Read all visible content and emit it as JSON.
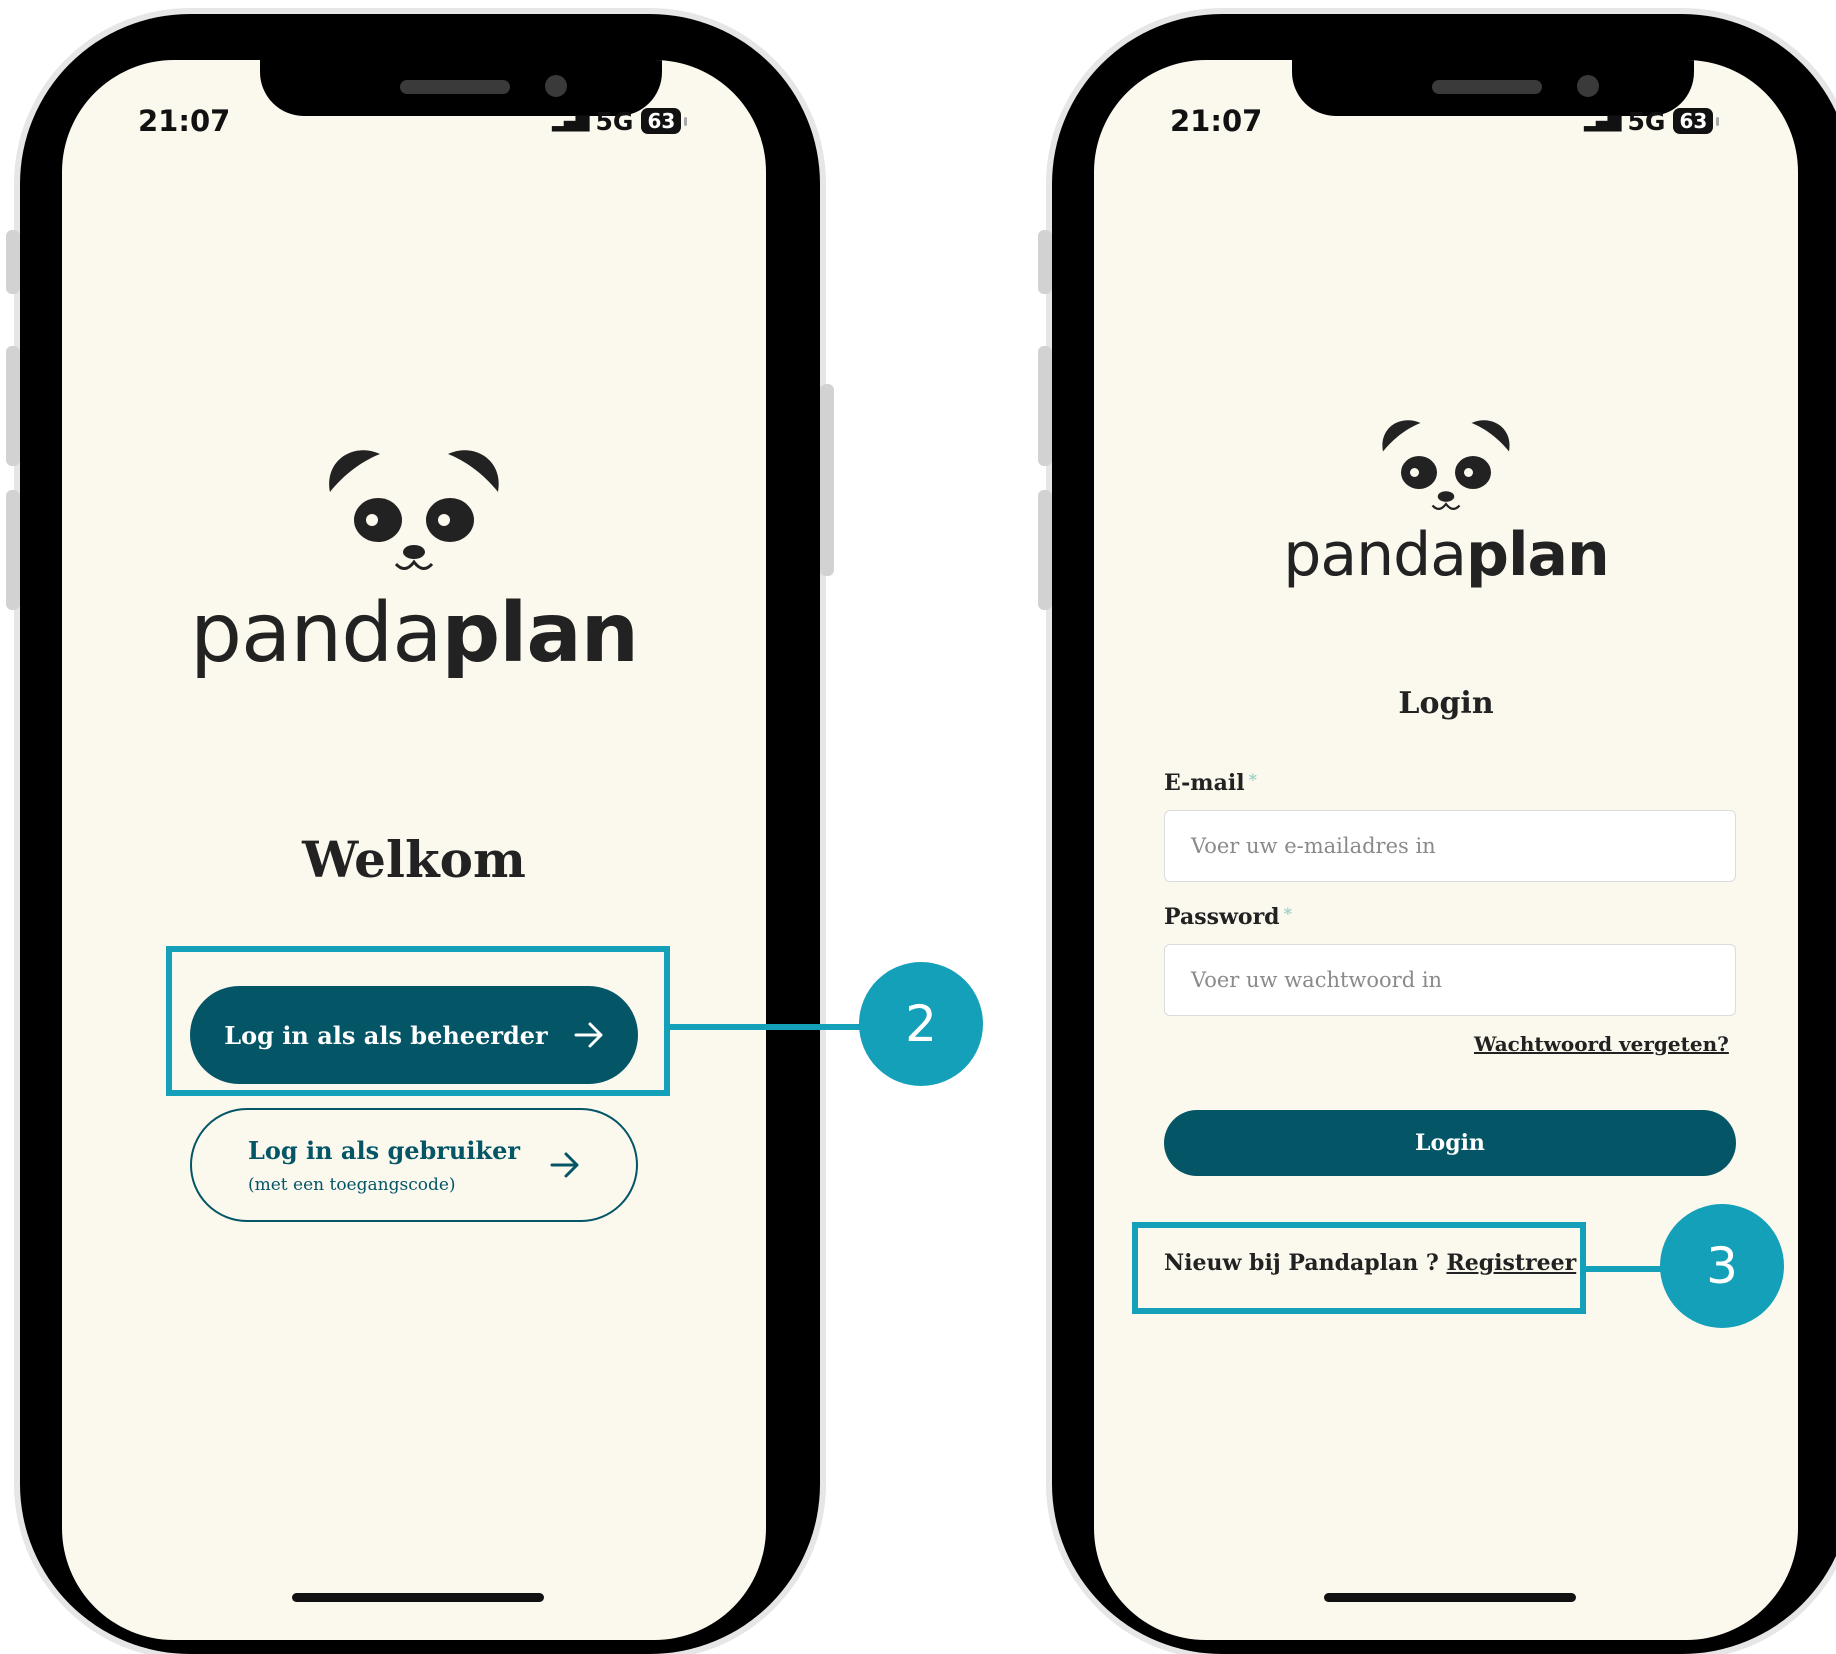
{
  "status": {
    "time": "21:07",
    "network": "5G",
    "battery": "63"
  },
  "brand": {
    "name_light": "panda",
    "name_bold": "plan"
  },
  "screen1": {
    "heading": "Welkom",
    "admin_button": "Log in als als beheerder",
    "user_button": "Log in als gebruiker",
    "user_button_sub": "(met een toegangscode)"
  },
  "screen2": {
    "heading": "Login",
    "email_label": "E-mail",
    "email_placeholder": "Voer uw e-mailadres in",
    "password_label": "Password",
    "password_placeholder": "Voer uw wachtwoord in",
    "required_mark": "*",
    "forgot_link": "Wachtwoord vergeten?",
    "login_button": "Login",
    "register_prompt": "Nieuw bij Pandaplan ?",
    "register_link": "Registreer"
  },
  "callouts": {
    "first": "2",
    "second": "3"
  },
  "colors": {
    "primary": "#045566",
    "callout": "#14a0b9",
    "screen_bg": "#fbf8ee"
  }
}
